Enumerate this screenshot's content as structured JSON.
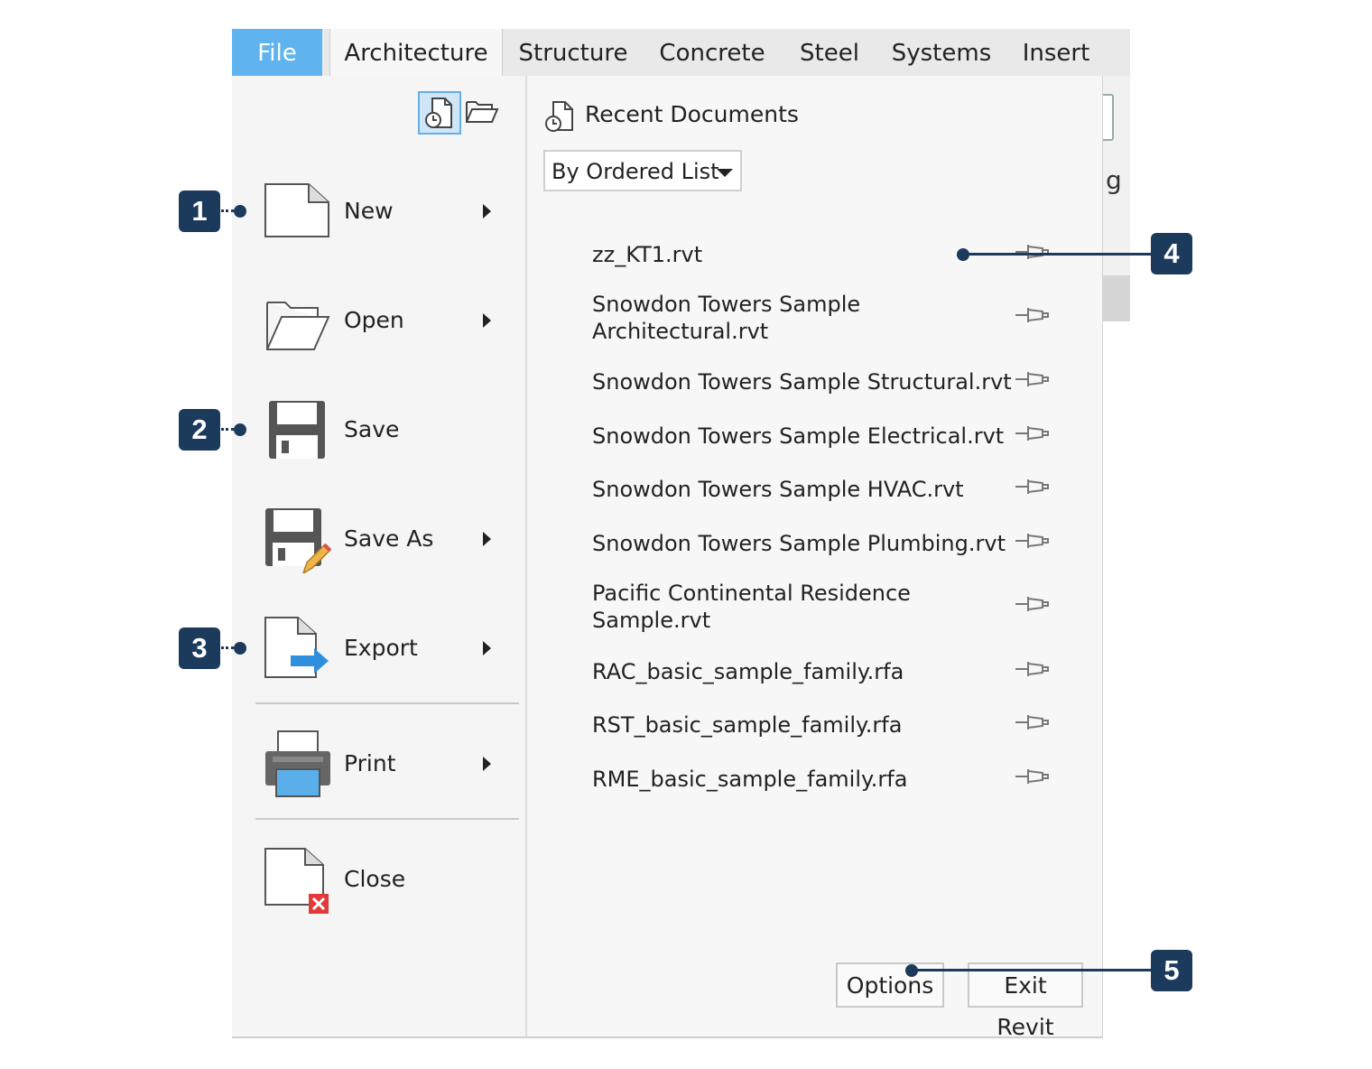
{
  "tabs": [
    "File",
    "Architecture",
    "Structure",
    "Concrete",
    "Steel",
    "Systems",
    "Insert"
  ],
  "background_fragment": "g",
  "menu": {
    "new": "New",
    "open": "Open",
    "save": "Save",
    "save_as": "Save As",
    "export": "Export",
    "print": "Print",
    "close": "Close"
  },
  "recent": {
    "title": "Recent Documents",
    "sort": "By Ordered List",
    "documents": [
      "zz_KT1.rvt",
      "Snowdon Towers Sample Architectural.rvt",
      "Snowdon Towers Sample Structural.rvt",
      "Snowdon Towers Sample Electrical.rvt",
      "Snowdon Towers Sample HVAC.rvt",
      "Snowdon Towers Sample Plumbing.rvt",
      "Pacific Continental Residence Sample.rvt",
      "RAC_basic_sample_family.rfa",
      "RST_basic_sample_family.rfa",
      "RME_basic_sample_family.rfa"
    ]
  },
  "buttons": {
    "options": "Options",
    "exit": "Exit Revit"
  },
  "callouts": [
    "1",
    "2",
    "3",
    "4",
    "5"
  ],
  "colors": {
    "file_tab": "#5fb4ef",
    "callout": "#1b3a5c",
    "export_arrow": "#2f8fdd",
    "close_x": "#e03a3a"
  }
}
